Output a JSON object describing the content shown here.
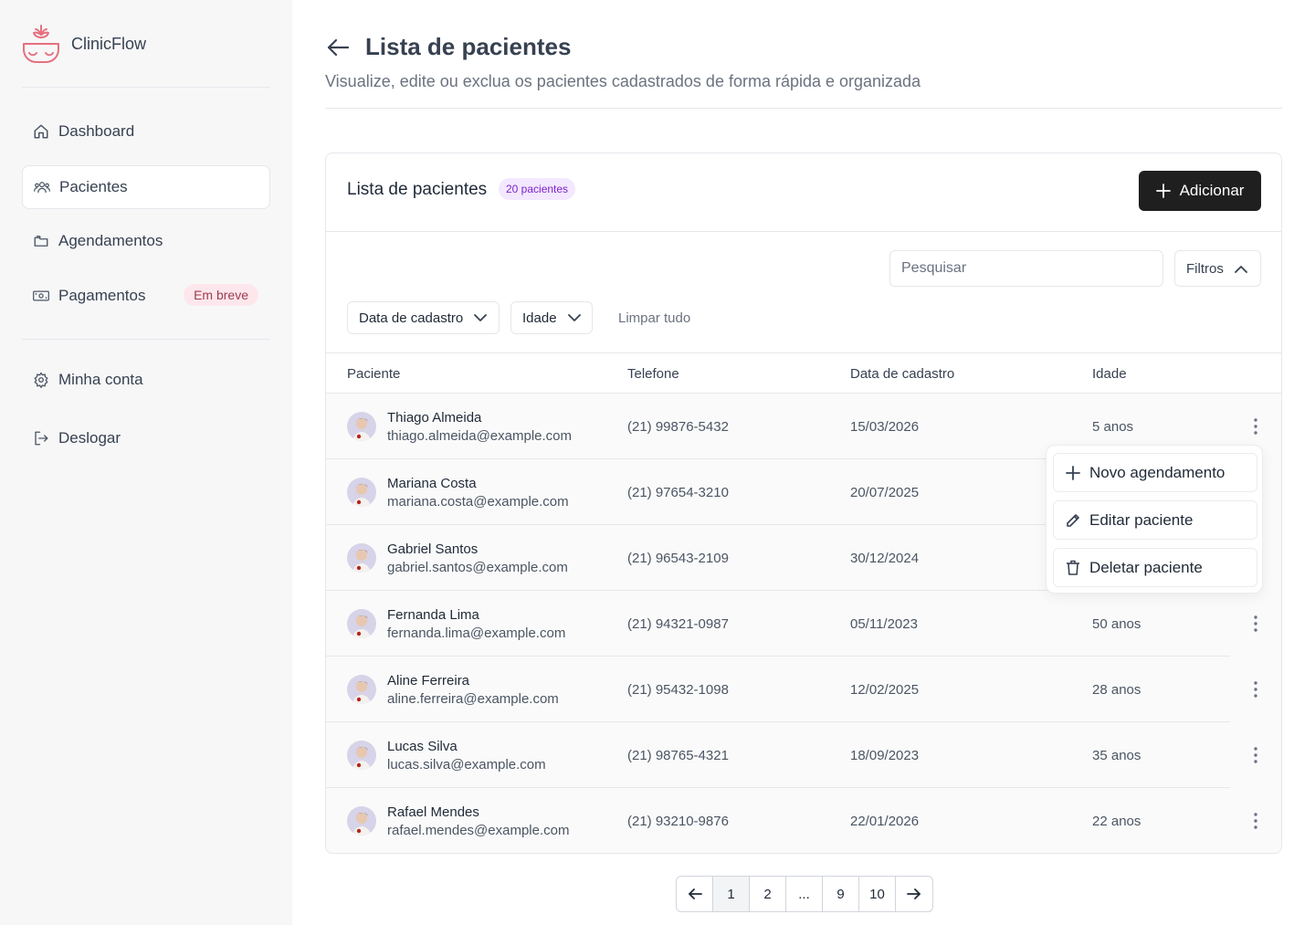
{
  "sidebar": {
    "brand": "ClinicFlow",
    "items": [
      {
        "label": "Dashboard"
      },
      {
        "label": "Pacientes"
      },
      {
        "label": "Agendamentos"
      },
      {
        "label": "Pagamentos",
        "badge": "Em breve"
      },
      {
        "label": "Minha conta"
      },
      {
        "label": "Deslogar"
      }
    ]
  },
  "header": {
    "title": "Lista de pacientes",
    "subtitle": "Visualize, edite ou exclua os pacientes cadastrados de forma rápida e organizada"
  },
  "card": {
    "title": "Lista de pacientes",
    "count_badge": "20 pacientes",
    "add_label": "Adicionar",
    "search_placeholder": "Pesquisar",
    "filters_label": "Filtros",
    "filter_dropdowns": [
      "Data de cadastro",
      "Idade"
    ],
    "clear_label": "Limpar tudo"
  },
  "table": {
    "columns": [
      "Paciente",
      "Telefone",
      "Data de cadastro",
      "Idade"
    ],
    "rows": [
      {
        "name": "Thiago Almeida",
        "email": "thiago.almeida@example.com",
        "phone": "(21) 99876-5432",
        "date": "15/03/2026",
        "age": "5 anos"
      },
      {
        "name": "Mariana Costa",
        "email": "mariana.costa@example.com",
        "phone": "(21) 97654-3210",
        "date": "20/07/2025",
        "age": ""
      },
      {
        "name": "Gabriel Santos",
        "email": "gabriel.santos@example.com",
        "phone": "(21) 96543-2109",
        "date": "30/12/2024",
        "age": ""
      },
      {
        "name": "Fernanda Lima",
        "email": "fernanda.lima@example.com",
        "phone": "(21) 94321-0987",
        "date": "05/11/2023",
        "age": "50 anos"
      },
      {
        "name": "Aline Ferreira",
        "email": "aline.ferreira@example.com",
        "phone": "(21) 95432-1098",
        "date": "12/02/2025",
        "age": "28 anos"
      },
      {
        "name": "Lucas Silva",
        "email": "lucas.silva@example.com",
        "phone": "(21) 98765-4321",
        "date": "18/09/2023",
        "age": "35 anos"
      },
      {
        "name": "Rafael Mendes",
        "email": "rafael.mendes@example.com",
        "phone": "(21) 93210-9876",
        "date": "22/01/2026",
        "age": "22 anos"
      }
    ]
  },
  "row_menu": {
    "items": [
      {
        "label": "Novo agendamento",
        "icon": "plus-icon"
      },
      {
        "label": "Editar paciente",
        "icon": "pencil-icon"
      },
      {
        "label": "Deletar paciente",
        "icon": "trash-icon"
      }
    ]
  },
  "pagination": {
    "pages": [
      "1",
      "2",
      "...",
      "9",
      "10"
    ],
    "current": "1"
  },
  "colors": {
    "brand_accent": "#e5707e",
    "primary_button": "#1f1f1f",
    "count_badge_bg": "#f3e8ff",
    "count_badge_text": "#7e22ce",
    "soon_badge_bg": "#fde7ec"
  }
}
